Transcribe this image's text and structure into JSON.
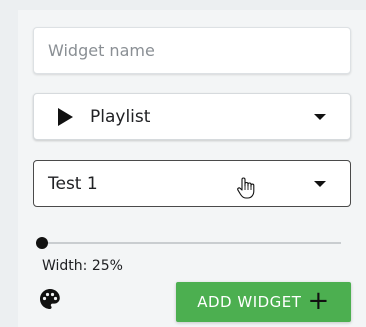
{
  "widget_form": {
    "name_placeholder": "Widget name",
    "type_select": {
      "value": "Playlist",
      "icon": "play-icon"
    },
    "source_select": {
      "value": "Test 1"
    },
    "width": {
      "label": "Width: 25%",
      "percent": 25
    },
    "palette_icon": "palette-icon",
    "add_button": {
      "label": "ADD WIDGET",
      "icon": "plus-icon"
    },
    "colors": {
      "accent": "#4caf50",
      "background": "#f3f5f6"
    }
  }
}
